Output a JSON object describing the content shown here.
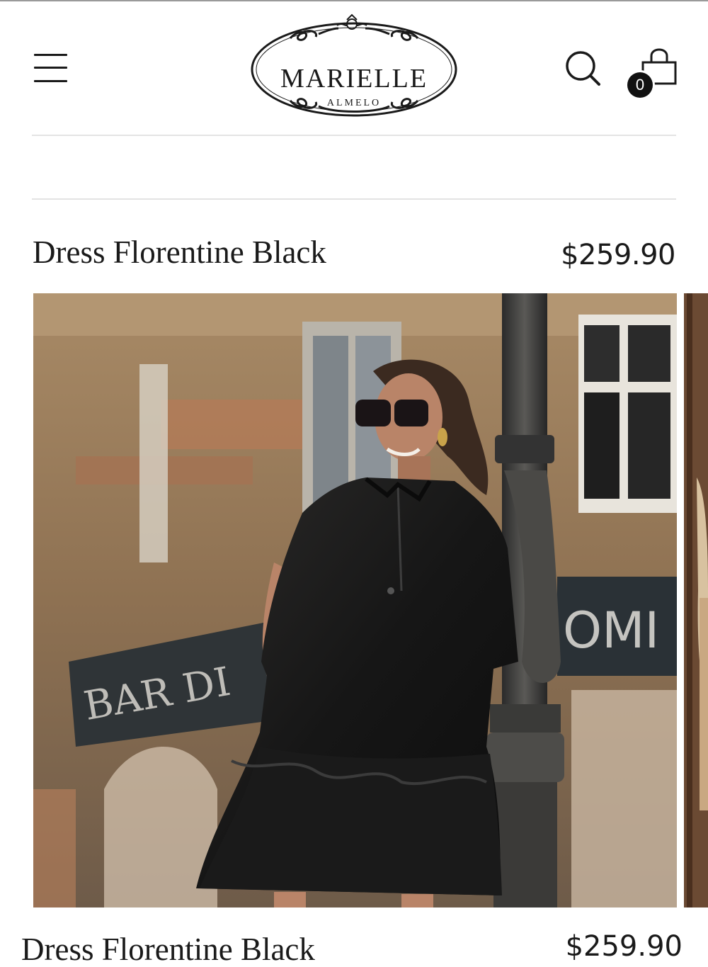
{
  "header": {
    "brand_name": "MARIELLE",
    "brand_location": "ALMELO",
    "menu_icon": "hamburger-menu-icon",
    "search_icon": "search-icon",
    "cart_icon": "shopping-bag-icon",
    "cart_count": "0"
  },
  "product": {
    "title": "Dress Florentine Black",
    "price": "$259.90",
    "image_subject": "woman in black ruffled dress leaning on street lamp post"
  },
  "next_product": {
    "title": "Dress Florentine Black",
    "price": "$259.90"
  },
  "colors": {
    "text": "#1a1a1a",
    "badge_bg": "#111111",
    "divider": "#e3e3e3"
  }
}
